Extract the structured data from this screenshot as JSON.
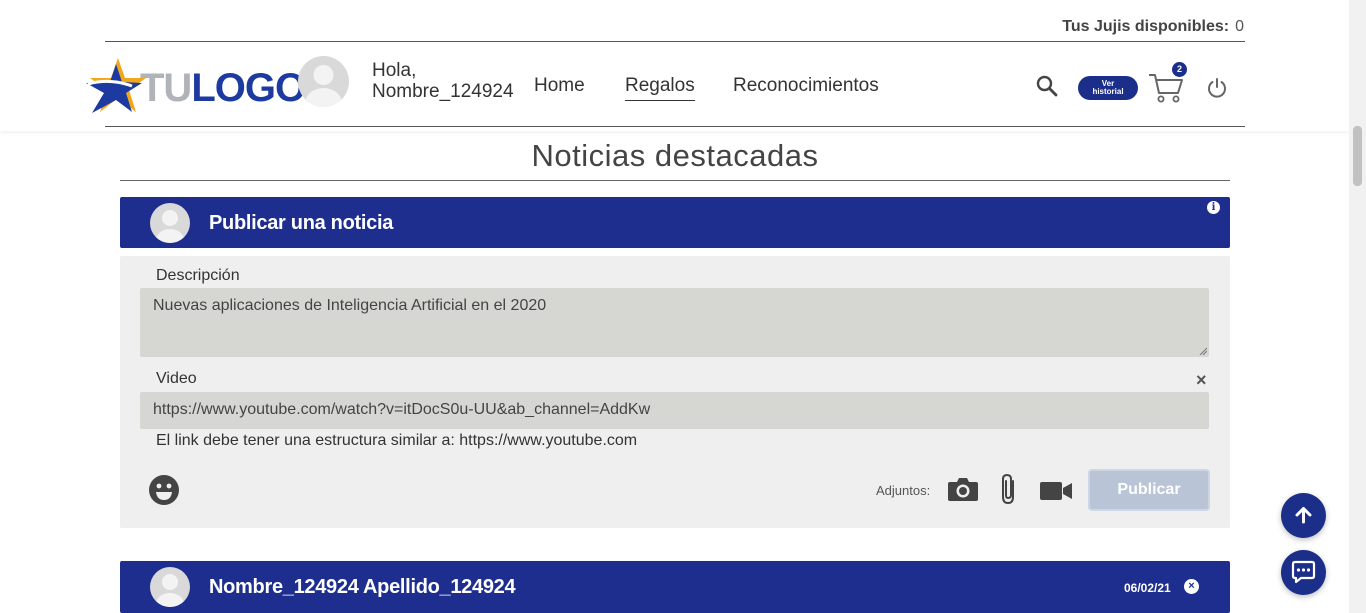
{
  "header": {
    "jujis_label": "Tus Jujis disponibles:",
    "jujis_value": "0",
    "logo": {
      "part1": "TU",
      "part2": "LOGO"
    },
    "greeting_line1": "Hola,",
    "greeting_line2": "Nombre_124924",
    "nav": [
      {
        "label": "Home",
        "active": false
      },
      {
        "label": "Regalos",
        "active": true
      },
      {
        "label": "Reconocimientos",
        "active": false
      }
    ],
    "ver_historial_line1": "Ver",
    "ver_historial_line2": "historial",
    "cart_count": "2"
  },
  "main": {
    "title": "Noticias destacadas"
  },
  "publish": {
    "title": "Publicar una noticia",
    "info_icon": "i",
    "description_label": "Descripción",
    "description_value": "Nuevas aplicaciones de Inteligencia Artificial en el 2020",
    "video_label": "Video",
    "video_value": "https://www.youtube.com/watch?v=itDocS0u-UU&ab_channel=AddKw",
    "hint": "El link debe tener una estructura similar a: https://www.youtube.com",
    "close_symbol": "×",
    "attachments_label": "Adjuntos:",
    "publish_button": "Publicar"
  },
  "post": {
    "author": "Nombre_124924 Apellido_124924",
    "date": "06/02/21",
    "close_symbol": "×"
  },
  "colors": {
    "primary": "#1e2e8e",
    "input_bg": "#d6d6d3",
    "panel_bg": "#efefef",
    "disabled_btn": "#b9c4d6"
  }
}
